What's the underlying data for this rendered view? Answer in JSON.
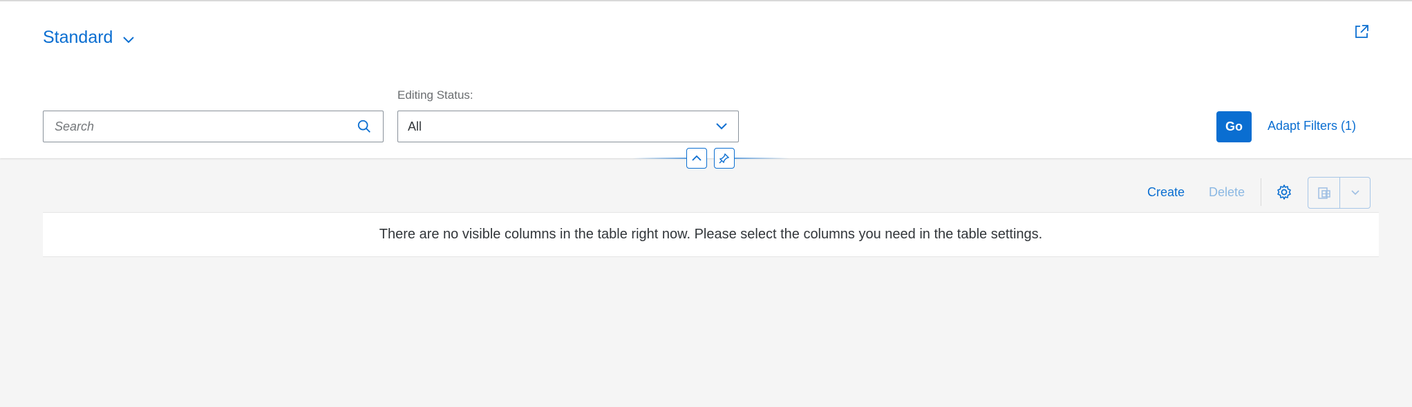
{
  "variant": {
    "name": "Standard"
  },
  "search": {
    "placeholder": "Search"
  },
  "filters": {
    "editing_status": {
      "label": "Editing Status:",
      "value": "All"
    }
  },
  "actions": {
    "go": "Go",
    "adapt_filters": "Adapt Filters (1)"
  },
  "table_toolbar": {
    "create": "Create",
    "delete": "Delete"
  },
  "table": {
    "no_data_text": "There are no visible columns in the table right now. Please select the columns you need in the table settings."
  },
  "colors": {
    "accent": "#0a6ed1",
    "disabled": "#8bb8e3",
    "background": "#f5f5f5"
  },
  "icons": [
    "chevron-down-icon",
    "share-icon",
    "search-icon",
    "collapse-up-icon",
    "pin-icon",
    "gear-icon",
    "export-spreadsheet-icon"
  ]
}
